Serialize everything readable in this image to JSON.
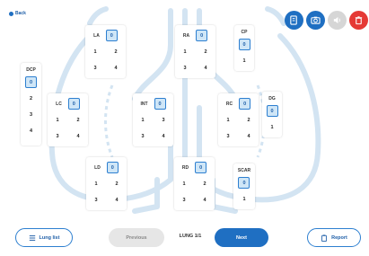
{
  "nav": {
    "back_label": "Back"
  },
  "toolbar": {
    "buttons": [
      {
        "name": "notes-button",
        "icon": "document-edit-icon",
        "color": "#1f6fc2"
      },
      {
        "name": "camera-button",
        "icon": "camera-icon",
        "color": "#1f6fc2"
      },
      {
        "name": "sound-button",
        "icon": "speaker-icon",
        "color": "#d6d6d6"
      },
      {
        "name": "delete-button",
        "icon": "trash-icon",
        "color": "#e53935"
      }
    ]
  },
  "zones": {
    "la": {
      "title": "LA",
      "selected": "0",
      "options": [
        "1",
        "2",
        "3",
        "4"
      ]
    },
    "ra": {
      "title": "RA",
      "selected": "0",
      "options": [
        "1",
        "2",
        "3",
        "4"
      ]
    },
    "cp": {
      "title": "CP",
      "selected": "0",
      "options": [
        "1"
      ]
    },
    "dcp": {
      "title": "DCP",
      "selected": "0",
      "options": [
        "2",
        "3",
        "4"
      ]
    },
    "lc": {
      "title": "LC",
      "selected": "0",
      "options": [
        "1",
        "2",
        "3",
        "4"
      ]
    },
    "int": {
      "title": "INT",
      "selected": "0",
      "options": [
        "1",
        "3",
        "3",
        "4"
      ]
    },
    "rc": {
      "title": "RC",
      "selected": "0",
      "options": [
        "1",
        "2",
        "3",
        "4"
      ]
    },
    "dg": {
      "title": "DG",
      "selected": "0",
      "options": [
        "1"
      ]
    },
    "ld": {
      "title": "LD",
      "selected": "0",
      "options": [
        "1",
        "2",
        "3",
        "4"
      ]
    },
    "rd": {
      "title": "RD",
      "selected": "0",
      "options": [
        "1",
        "2",
        "3",
        "4"
      ]
    },
    "scar": {
      "title": "SCAR",
      "selected": "0",
      "options": [
        "1"
      ]
    }
  },
  "footer": {
    "lung_list_label": "Lung list",
    "previous_label": "Previous",
    "page_label": "LUNG 1/1",
    "next_label": "Next",
    "report_label": "Report"
  },
  "colors": {
    "accent": "#1f6fc2",
    "selected_bg": "#cfe6f7",
    "delete": "#e53935",
    "disabled": "#d6d6d6"
  }
}
